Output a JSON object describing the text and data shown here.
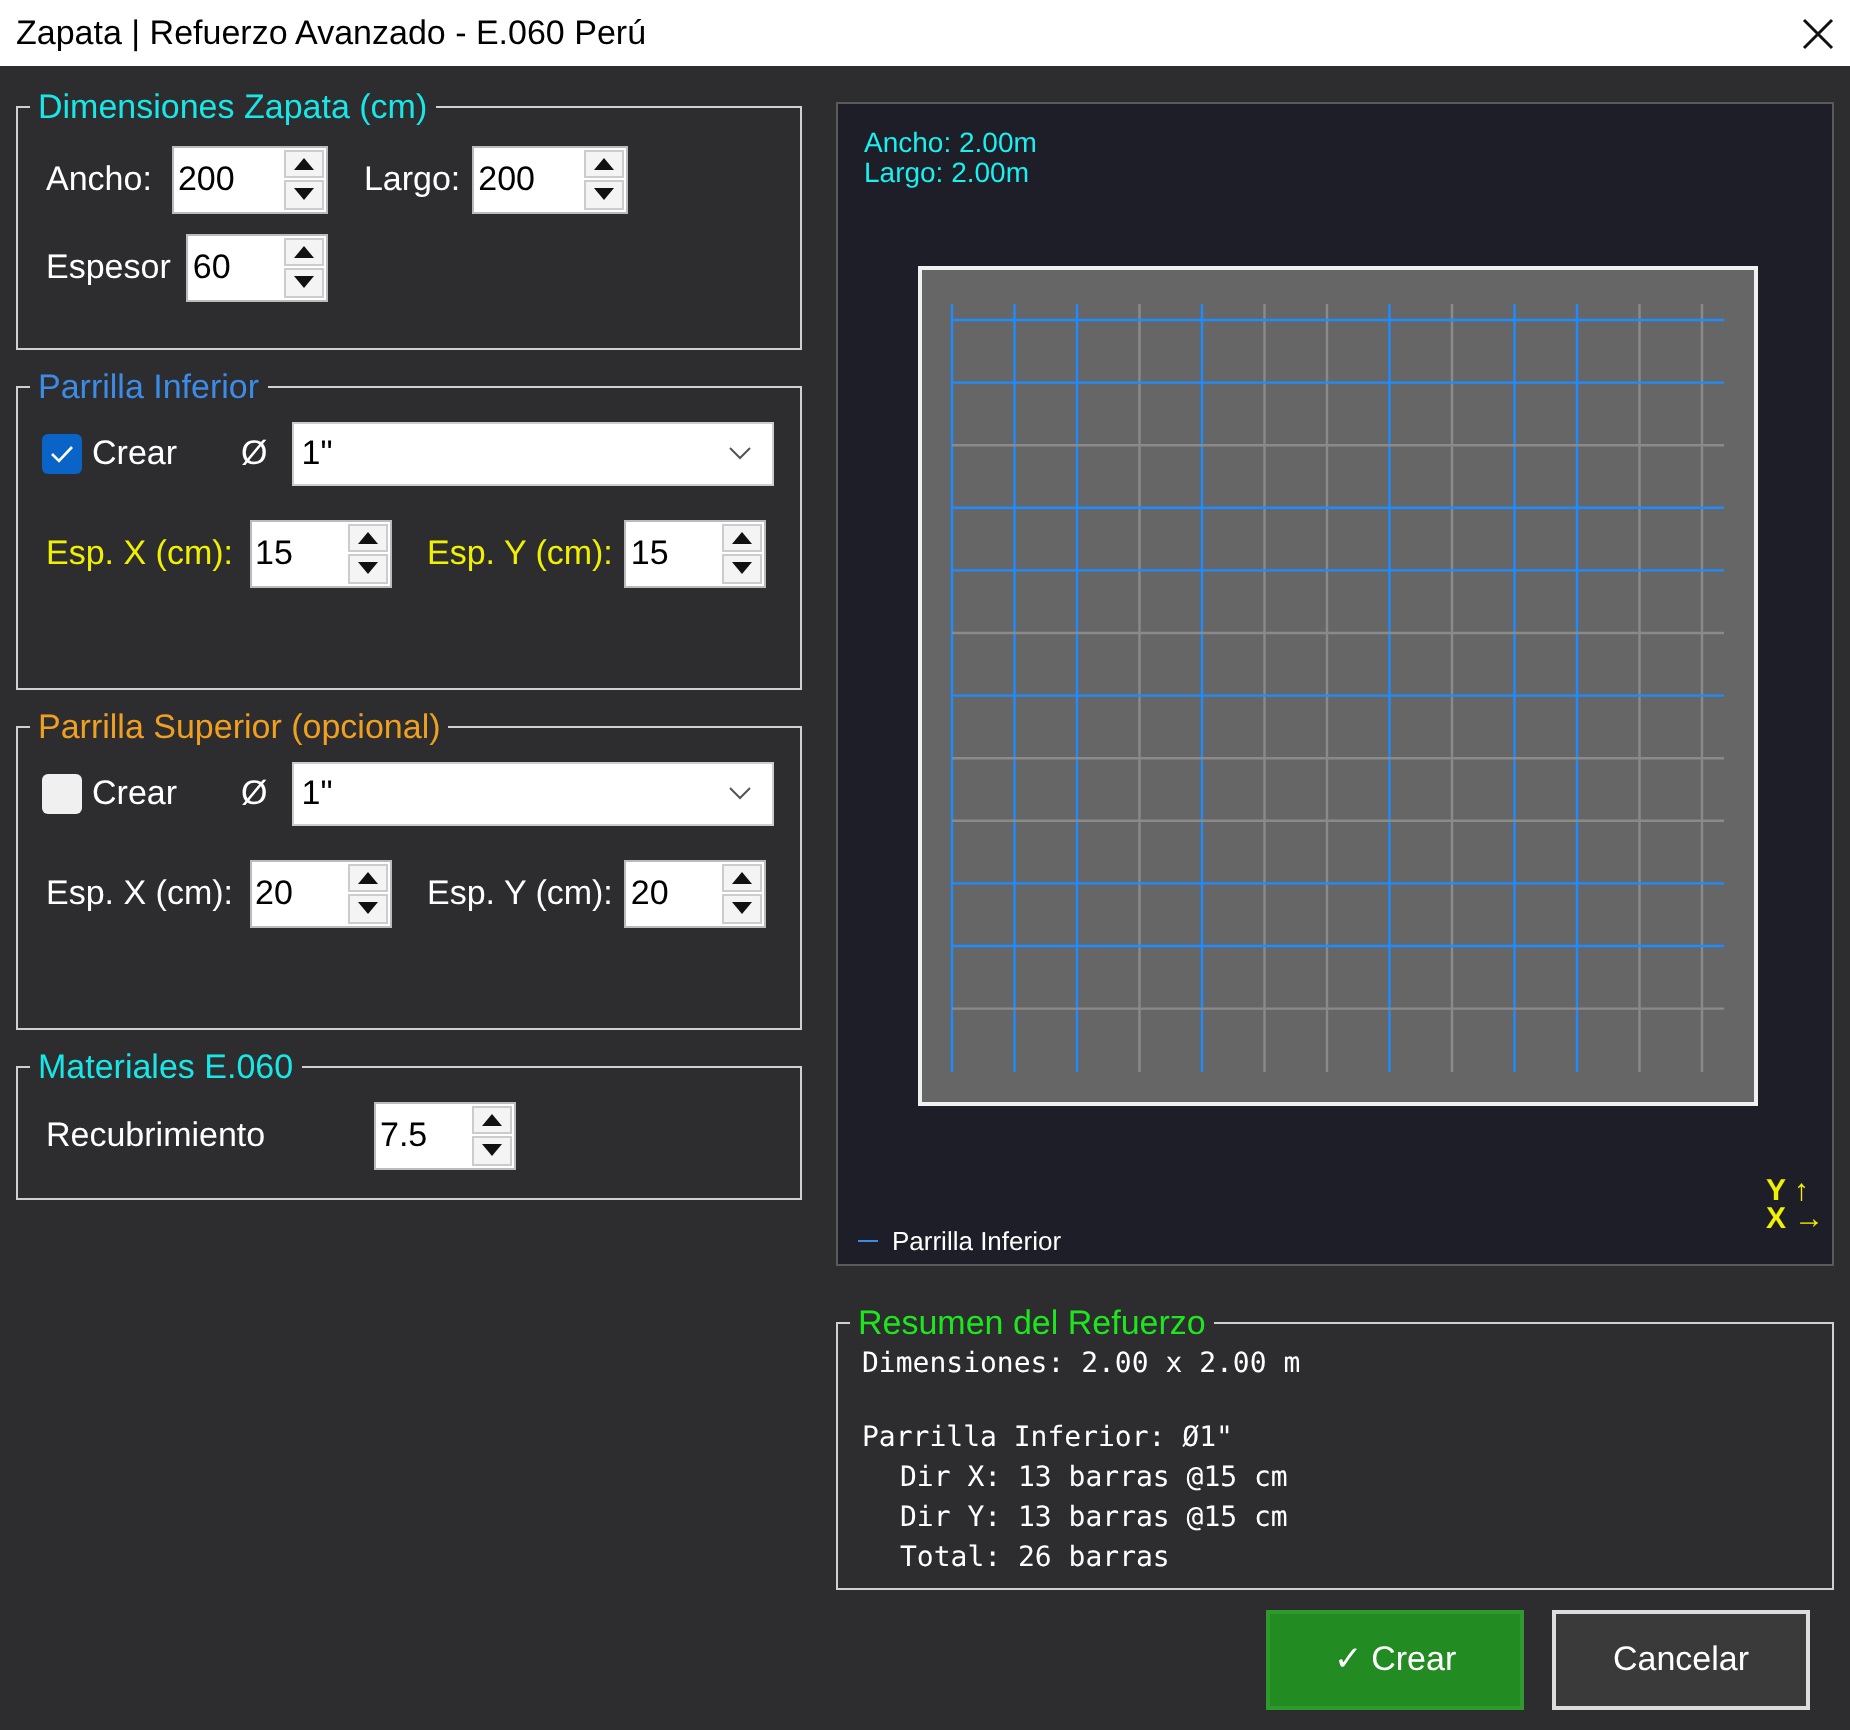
{
  "window": {
    "title": "Zapata | Refuerzo Avanzado - E.060 Perú"
  },
  "dimensiones": {
    "title": "Dimensiones Zapata (cm)",
    "fields": [
      {
        "label": "Ancho:",
        "value": "200"
      },
      {
        "label": "Largo:",
        "value": "200"
      },
      {
        "label": "Espesor",
        "value": "60"
      }
    ]
  },
  "grids": [
    {
      "title": "Parrilla Inferior",
      "color": "#3c8ce6",
      "crear": {
        "label": "Crear",
        "checked": true
      },
      "diameter_label": "Ø",
      "diameter": "1\"",
      "spacing": [
        {
          "label": "Esp. X (cm):",
          "value": "15"
        },
        {
          "label": "Esp. Y (cm):",
          "value": "15"
        }
      ]
    },
    {
      "title": "Parrilla Superior (opcional)",
      "color": "#f0a020",
      "crear": {
        "label": "Crear",
        "checked": false
      },
      "diameter_label": "Ø",
      "diameter": "1\"",
      "spacing": [
        {
          "label": "Esp. X (cm):",
          "value": "20"
        },
        {
          "label": "Esp. Y (cm):",
          "value": "20"
        }
      ]
    }
  ],
  "materiales": {
    "title": "Materiales E.060",
    "fields": [
      {
        "label": "Recubrimiento",
        "value": "7.5"
      }
    ]
  },
  "preview": {
    "labels": [
      "Ancho: 2.00m",
      "Largo: 2.00m"
    ],
    "legend": "Parrilla Inferior",
    "axes": [
      {
        "letter": "Y",
        "arrow": "↑"
      },
      {
        "letter": "X",
        "arrow": "→"
      }
    ]
  },
  "summary": {
    "title": "Resumen del Refuerzo",
    "blocks": [
      {
        "text": "Dimensiones: 2.00 x 2.00 m"
      },
      {
        "text": "Parrilla Inferior: Ø1\"",
        "children": [
          "Dir X: 13 barras @15 cm",
          "Dir Y: 13 barras @15 cm",
          "Total: 26 barras"
        ]
      }
    ]
  },
  "buttons": [
    {
      "label": "✓ Crear",
      "kind": "primary"
    },
    {
      "label": "Cancelar",
      "kind": "secondary"
    }
  ]
}
